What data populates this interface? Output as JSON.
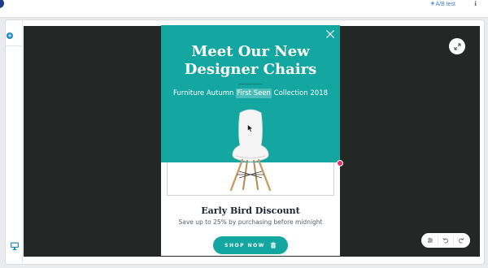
{
  "top_bar": {
    "ab_test_label": "A/B test"
  },
  "popup": {
    "title": "Meet Our New Designer Chairs",
    "subtitle_pre": "Furniture Autumn ",
    "subtitle_highlight": "First Seen",
    "subtitle_post": " Collection 2018",
    "heading": "Early Bird Discount",
    "text": "Save up to 25% by purchasing before midnight",
    "button_label": "SHOP NOW"
  },
  "colors": {
    "accent": "#14a7a2",
    "stage": "#232826",
    "handle": "#e8336d"
  },
  "icons": [
    "close-icon",
    "trash-icon",
    "resize-icon",
    "settings-icon",
    "undo-icon",
    "redo-icon",
    "desktop-icon",
    "add-icon",
    "info-icon",
    "cursor-icon"
  ]
}
